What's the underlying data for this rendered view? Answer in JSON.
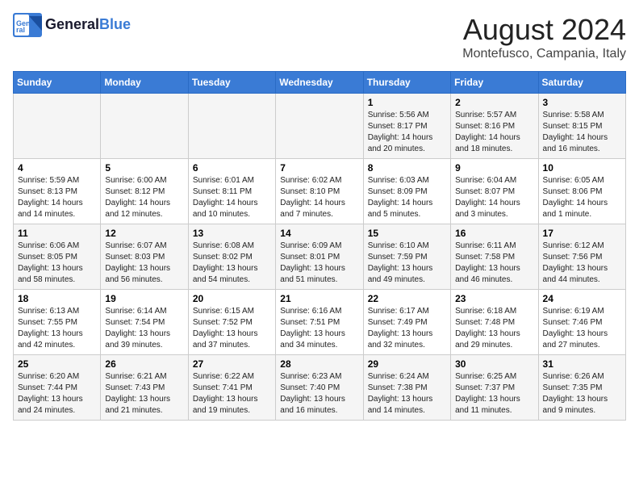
{
  "header": {
    "logo_line1": "General",
    "logo_line2": "Blue",
    "month_title": "August 2024",
    "location": "Montefusco, Campania, Italy"
  },
  "days_of_week": [
    "Sunday",
    "Monday",
    "Tuesday",
    "Wednesday",
    "Thursday",
    "Friday",
    "Saturday"
  ],
  "weeks": [
    [
      {
        "day": "",
        "info": ""
      },
      {
        "day": "",
        "info": ""
      },
      {
        "day": "",
        "info": ""
      },
      {
        "day": "",
        "info": ""
      },
      {
        "day": "1",
        "info": "Sunrise: 5:56 AM\nSunset: 8:17 PM\nDaylight: 14 hours\nand 20 minutes."
      },
      {
        "day": "2",
        "info": "Sunrise: 5:57 AM\nSunset: 8:16 PM\nDaylight: 14 hours\nand 18 minutes."
      },
      {
        "day": "3",
        "info": "Sunrise: 5:58 AM\nSunset: 8:15 PM\nDaylight: 14 hours\nand 16 minutes."
      }
    ],
    [
      {
        "day": "4",
        "info": "Sunrise: 5:59 AM\nSunset: 8:13 PM\nDaylight: 14 hours\nand 14 minutes."
      },
      {
        "day": "5",
        "info": "Sunrise: 6:00 AM\nSunset: 8:12 PM\nDaylight: 14 hours\nand 12 minutes."
      },
      {
        "day": "6",
        "info": "Sunrise: 6:01 AM\nSunset: 8:11 PM\nDaylight: 14 hours\nand 10 minutes."
      },
      {
        "day": "7",
        "info": "Sunrise: 6:02 AM\nSunset: 8:10 PM\nDaylight: 14 hours\nand 7 minutes."
      },
      {
        "day": "8",
        "info": "Sunrise: 6:03 AM\nSunset: 8:09 PM\nDaylight: 14 hours\nand 5 minutes."
      },
      {
        "day": "9",
        "info": "Sunrise: 6:04 AM\nSunset: 8:07 PM\nDaylight: 14 hours\nand 3 minutes."
      },
      {
        "day": "10",
        "info": "Sunrise: 6:05 AM\nSunset: 8:06 PM\nDaylight: 14 hours\nand 1 minute."
      }
    ],
    [
      {
        "day": "11",
        "info": "Sunrise: 6:06 AM\nSunset: 8:05 PM\nDaylight: 13 hours\nand 58 minutes."
      },
      {
        "day": "12",
        "info": "Sunrise: 6:07 AM\nSunset: 8:03 PM\nDaylight: 13 hours\nand 56 minutes."
      },
      {
        "day": "13",
        "info": "Sunrise: 6:08 AM\nSunset: 8:02 PM\nDaylight: 13 hours\nand 54 minutes."
      },
      {
        "day": "14",
        "info": "Sunrise: 6:09 AM\nSunset: 8:01 PM\nDaylight: 13 hours\nand 51 minutes."
      },
      {
        "day": "15",
        "info": "Sunrise: 6:10 AM\nSunset: 7:59 PM\nDaylight: 13 hours\nand 49 minutes."
      },
      {
        "day": "16",
        "info": "Sunrise: 6:11 AM\nSunset: 7:58 PM\nDaylight: 13 hours\nand 46 minutes."
      },
      {
        "day": "17",
        "info": "Sunrise: 6:12 AM\nSunset: 7:56 PM\nDaylight: 13 hours\nand 44 minutes."
      }
    ],
    [
      {
        "day": "18",
        "info": "Sunrise: 6:13 AM\nSunset: 7:55 PM\nDaylight: 13 hours\nand 42 minutes."
      },
      {
        "day": "19",
        "info": "Sunrise: 6:14 AM\nSunset: 7:54 PM\nDaylight: 13 hours\nand 39 minutes."
      },
      {
        "day": "20",
        "info": "Sunrise: 6:15 AM\nSunset: 7:52 PM\nDaylight: 13 hours\nand 37 minutes."
      },
      {
        "day": "21",
        "info": "Sunrise: 6:16 AM\nSunset: 7:51 PM\nDaylight: 13 hours\nand 34 minutes."
      },
      {
        "day": "22",
        "info": "Sunrise: 6:17 AM\nSunset: 7:49 PM\nDaylight: 13 hours\nand 32 minutes."
      },
      {
        "day": "23",
        "info": "Sunrise: 6:18 AM\nSunset: 7:48 PM\nDaylight: 13 hours\nand 29 minutes."
      },
      {
        "day": "24",
        "info": "Sunrise: 6:19 AM\nSunset: 7:46 PM\nDaylight: 13 hours\nand 27 minutes."
      }
    ],
    [
      {
        "day": "25",
        "info": "Sunrise: 6:20 AM\nSunset: 7:44 PM\nDaylight: 13 hours\nand 24 minutes."
      },
      {
        "day": "26",
        "info": "Sunrise: 6:21 AM\nSunset: 7:43 PM\nDaylight: 13 hours\nand 21 minutes."
      },
      {
        "day": "27",
        "info": "Sunrise: 6:22 AM\nSunset: 7:41 PM\nDaylight: 13 hours\nand 19 minutes."
      },
      {
        "day": "28",
        "info": "Sunrise: 6:23 AM\nSunset: 7:40 PM\nDaylight: 13 hours\nand 16 minutes."
      },
      {
        "day": "29",
        "info": "Sunrise: 6:24 AM\nSunset: 7:38 PM\nDaylight: 13 hours\nand 14 minutes."
      },
      {
        "day": "30",
        "info": "Sunrise: 6:25 AM\nSunset: 7:37 PM\nDaylight: 13 hours\nand 11 minutes."
      },
      {
        "day": "31",
        "info": "Sunrise: 6:26 AM\nSunset: 7:35 PM\nDaylight: 13 hours\nand 9 minutes."
      }
    ]
  ]
}
